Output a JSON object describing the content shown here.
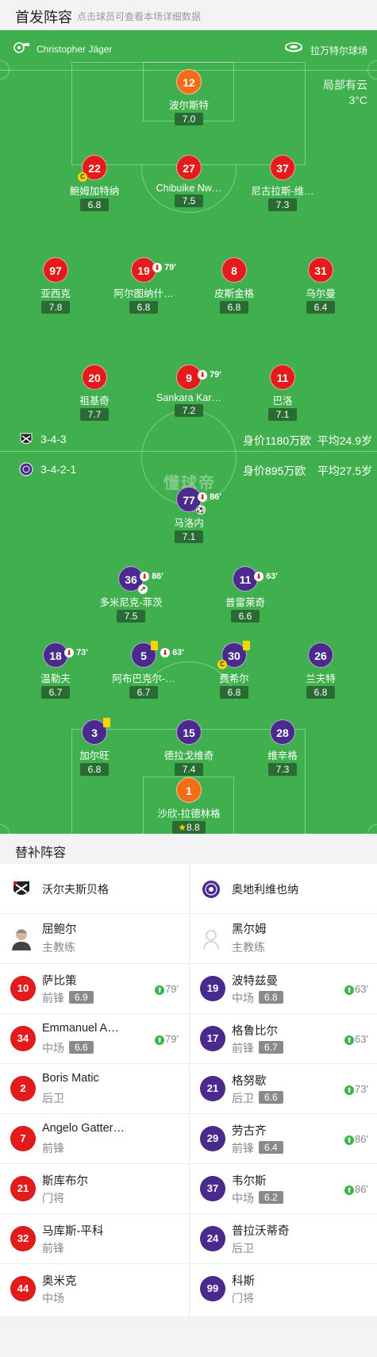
{
  "header": {
    "title": "首发阵容",
    "subtitle": "点击球员可查看本场详细数据"
  },
  "match": {
    "referee": "Christopher Jäger",
    "venue": "拉万特尔球场",
    "weather": "局部有云",
    "temperature": "3°C",
    "brand": "懂球帝"
  },
  "home": {
    "formation": "3-4-3",
    "market_value": "身价1180万欧",
    "avg_age": "平均24.9岁",
    "color": "#e31b1b",
    "players": [
      {
        "num": "12",
        "name": "波尔斯特",
        "rating": "7.0"
      },
      {
        "num": "22",
        "name": "鲍姆加特纳",
        "rating": "6.8"
      },
      {
        "num": "27",
        "name": "Chibuike Nw…",
        "rating": "7.5"
      },
      {
        "num": "37",
        "name": "尼古拉斯-维…",
        "rating": "7.3"
      },
      {
        "num": "97",
        "name": "亚西克",
        "rating": "7.8"
      },
      {
        "num": "19",
        "name": "阿尔图纳什…",
        "rating": "6.8",
        "sub_off": "79'"
      },
      {
        "num": "8",
        "name": "皮斯金格",
        "rating": "6.8"
      },
      {
        "num": "31",
        "name": "乌尔曼",
        "rating": "6.4"
      },
      {
        "num": "20",
        "name": "祖基奇",
        "rating": "7.7"
      },
      {
        "num": "9",
        "name": "Sankara Kar…",
        "rating": "7.2",
        "sub_off": "79'"
      },
      {
        "num": "11",
        "name": "巴洛",
        "rating": "7.1"
      }
    ]
  },
  "away": {
    "formation": "3-4-2-1",
    "market_value": "身价895万欧",
    "avg_age": "平均27.5岁",
    "color": "#4b2a8d",
    "players": [
      {
        "num": "77",
        "name": "马洛内",
        "rating": "7.1",
        "sub_off": "86'"
      },
      {
        "num": "36",
        "name": "多米尼克-菲茨",
        "rating": "7.5",
        "sub_off": "86'"
      },
      {
        "num": "11",
        "name": "普雷莱奇",
        "rating": "6.6",
        "sub_off": "63'"
      },
      {
        "num": "18",
        "name": "温勒夫",
        "rating": "6.7",
        "sub_off": "73'"
      },
      {
        "num": "5",
        "name": "阿布巴克尔-…",
        "rating": "6.7",
        "sub_off": "63'"
      },
      {
        "num": "30",
        "name": "费希尔",
        "rating": "6.8"
      },
      {
        "num": "26",
        "name": "兰夫特",
        "rating": "6.8"
      },
      {
        "num": "3",
        "name": "加尔旺",
        "rating": "6.8"
      },
      {
        "num": "15",
        "name": "德拉戈维奇",
        "rating": "7.4"
      },
      {
        "num": "28",
        "name": "维辛格",
        "rating": "7.3"
      },
      {
        "num": "1",
        "name": "沙欣-拉德林格",
        "rating": "8.8",
        "mvp": true
      }
    ]
  },
  "subs": {
    "title": "替补阵容",
    "home_team": "沃尔夫斯贝格",
    "away_team": "奥地利维也纳",
    "home_coach": {
      "name": "屈鲍尔",
      "role": "主教练"
    },
    "away_coach": {
      "name": "黑尔姆",
      "role": "主教练"
    },
    "home": [
      {
        "num": "10",
        "name": "萨比策",
        "pos": "前锋",
        "rating": "6.9",
        "sub_in": "79'"
      },
      {
        "num": "34",
        "name": "Emmanuel A…",
        "pos": "中场",
        "rating": "6.6",
        "sub_in": "79'"
      },
      {
        "num": "2",
        "name": "Boris Matic",
        "pos": "后卫"
      },
      {
        "num": "7",
        "name": "Angelo Gatter…",
        "pos": "前锋"
      },
      {
        "num": "21",
        "name": "斯库布尔",
        "pos": "门将"
      },
      {
        "num": "32",
        "name": "马库斯-平科",
        "pos": "前锋"
      },
      {
        "num": "44",
        "name": "奥米克",
        "pos": "中场"
      }
    ],
    "away": [
      {
        "num": "19",
        "name": "波特兹曼",
        "pos": "中场",
        "rating": "6.8",
        "sub_in": "63'"
      },
      {
        "num": "17",
        "name": "格鲁比尔",
        "pos": "前锋",
        "rating": "6.7",
        "sub_in": "63'"
      },
      {
        "num": "21",
        "name": "格努歇",
        "pos": "后卫",
        "rating": "6.6",
        "sub_in": "73'"
      },
      {
        "num": "29",
        "name": "劳古齐",
        "pos": "前锋",
        "rating": "6.4",
        "sub_in": "86'"
      },
      {
        "num": "37",
        "name": "韦尔斯",
        "pos": "中场",
        "rating": "6.2",
        "sub_in": "86'"
      },
      {
        "num": "24",
        "name": "普拉沃蒂奇",
        "pos": "后卫"
      },
      {
        "num": "99",
        "name": "科斯",
        "pos": "门将"
      }
    ]
  }
}
